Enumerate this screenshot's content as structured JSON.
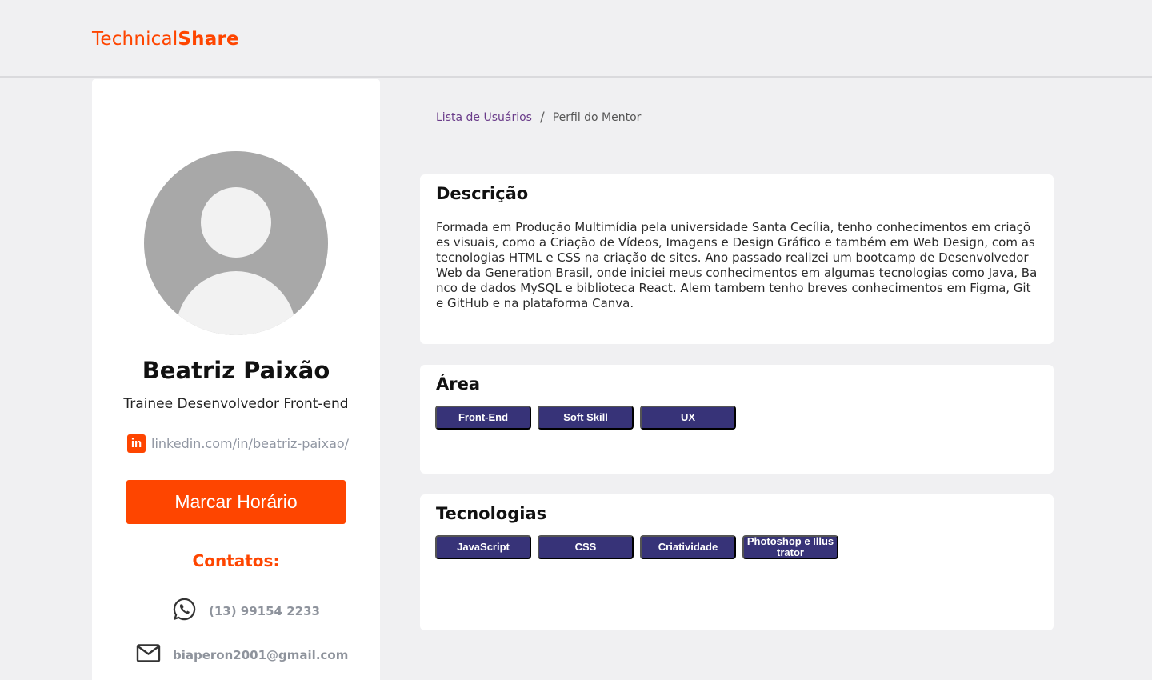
{
  "header": {
    "logo_regular": "Technical",
    "logo_bold": "Share"
  },
  "profile": {
    "name": "Beatriz Paixão",
    "role": "Trainee Desenvolvedor Front-end",
    "linkedin": "linkedin.com/in/beatriz-paixao/",
    "schedule_button": "Marcar Horário",
    "contacts_title": "Contatos:",
    "phone": "(13) 99154 2233",
    "email": "biaperon2001@gmail.com"
  },
  "breadcrumb": {
    "link": "Lista de Usuários",
    "separator": "/",
    "current": "Perfil do Mentor"
  },
  "description": {
    "title": "Descrição",
    "text": "Formada em Produção Multimídia pela universidade Santa Cecília, tenho conhecimentos em criações visuais, como a Criação de Vídeos, Imagens e Design Gráfico e também em Web Design, com as tecnologias HTML e CSS na criação de sites. Ano passado realizei um bootcamp de Desenvolvedor Web da Generation Brasil, onde iniciei meus conhecimentos em algumas tecnologias como Java, Banco de dados MySQL e biblioteca React. Alem tambem tenho breves conhecimentos em Figma, Git e GitHub e na plataforma Canva."
  },
  "area": {
    "title": "Área",
    "tags": [
      "Front-End",
      "Soft Skill",
      "UX"
    ]
  },
  "technologies": {
    "title": "Tecnologias",
    "tags": [
      "JavaScript",
      "CSS",
      "Criatividade",
      "Photoshop e Illustrator"
    ]
  },
  "icons": {
    "linkedin": "linkedin-icon",
    "phone": "whatsapp-icon",
    "email": "mail-icon",
    "avatar": "user-avatar-placeholder"
  },
  "colors": {
    "brand": "#fe4500",
    "tag": "#373378",
    "background": "#f0f0f2"
  }
}
